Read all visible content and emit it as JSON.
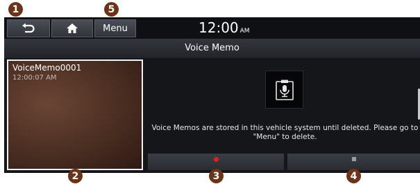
{
  "callouts": {
    "c1": "1",
    "c2": "2",
    "c3": "3",
    "c4": "4",
    "c5": "5"
  },
  "topbar": {
    "back_icon": "back-arrow-icon",
    "home_icon": "home-icon",
    "menu_label": "Menu",
    "time": "12:00",
    "ampm": "AM"
  },
  "title": "Voice Memo",
  "memo": {
    "name": "VoiceMemo0001",
    "time": "12:00:07 AM"
  },
  "mic_icon": "microphone-icon",
  "info_text": "Voice Memos are stored in this vehicle system until deleted. Please go to \"Menu\" to delete.",
  "controls": {
    "record_icon": "record-icon",
    "stop_icon": "stop-icon"
  },
  "colors": {
    "callout": "#6b3418",
    "record": "#e0201e",
    "screen_bg": "#15161a"
  }
}
